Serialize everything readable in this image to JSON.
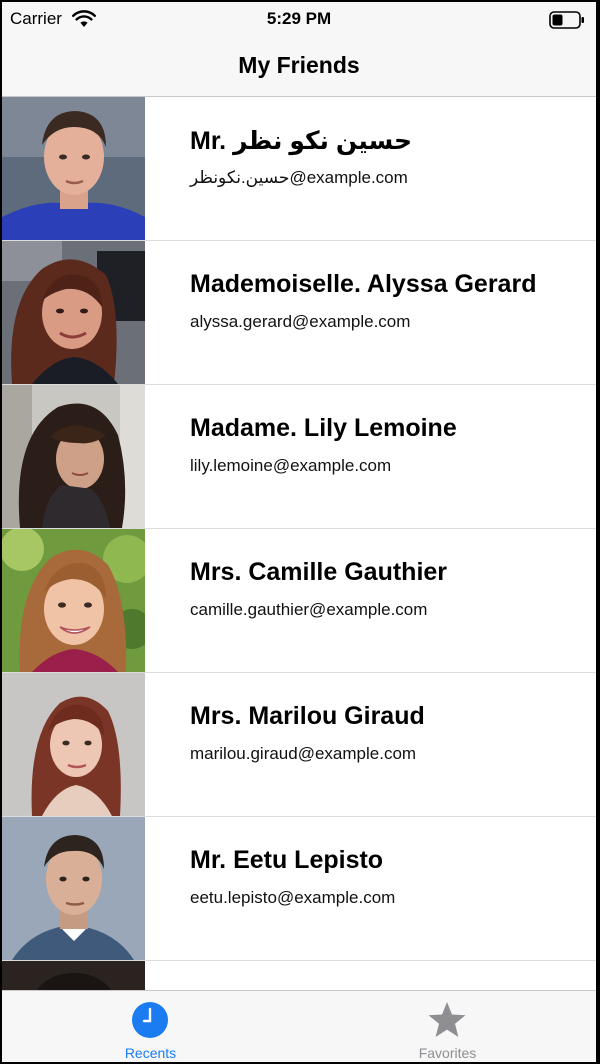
{
  "status_bar": {
    "carrier": "Carrier",
    "time": "5:29 PM",
    "icons": [
      "wifi-icon",
      "battery-icon"
    ]
  },
  "nav": {
    "title": "My Friends"
  },
  "friends": [
    {
      "name": "Mr. حسين نكو نظر",
      "email": "حسين.نكونظر@example.com",
      "avatar": "avatar-photo"
    },
    {
      "name": "Mademoiselle. Alyssa Gerard",
      "email": "alyssa.gerard@example.com",
      "avatar": "avatar-photo"
    },
    {
      "name": "Madame. Lily Lemoine",
      "email": "lily.lemoine@example.com",
      "avatar": "avatar-photo"
    },
    {
      "name": "Mrs. Camille Gauthier",
      "email": "camille.gauthier@example.com",
      "avatar": "avatar-photo"
    },
    {
      "name": "Mrs. Marilou Giraud",
      "email": "marilou.giraud@example.com",
      "avatar": "avatar-photo"
    },
    {
      "name": "Mr. Eetu Lepisto",
      "email": "eetu.lepisto@example.com",
      "avatar": "avatar-photo"
    },
    {
      "name": "",
      "email": "",
      "avatar": "avatar-photo"
    }
  ],
  "tabs": [
    {
      "label": "Recents",
      "icon": "clock-icon",
      "selected": true
    },
    {
      "label": "Favorites",
      "icon": "star-icon",
      "selected": false
    }
  ],
  "colors": {
    "accent": "#1a7cf0",
    "inactive": "#8e8e93",
    "bar_background": "#f7f7f7"
  }
}
